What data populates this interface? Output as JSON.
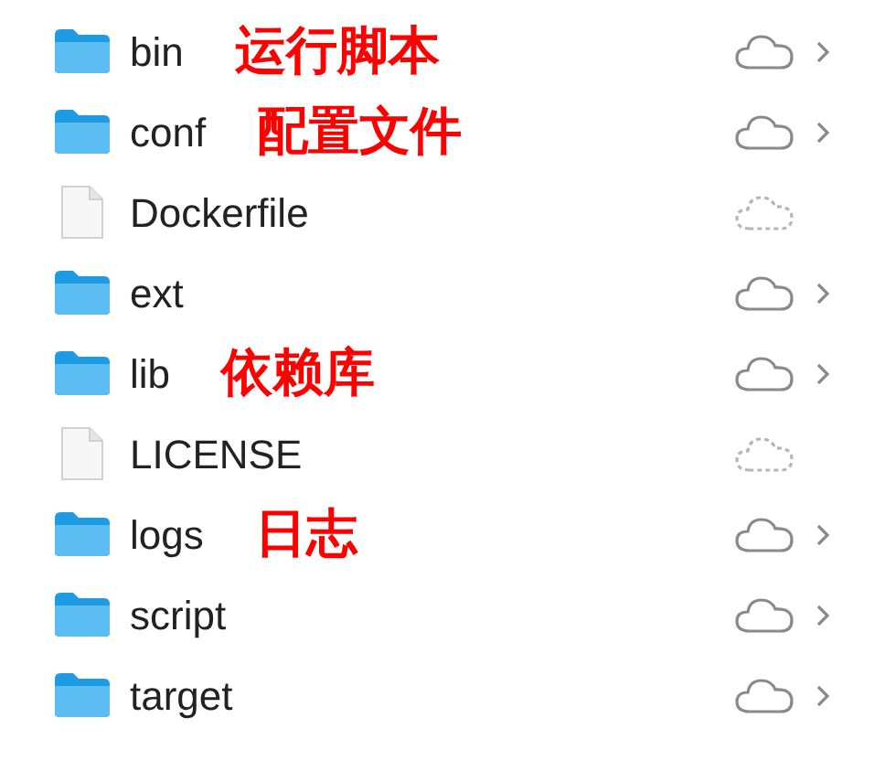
{
  "items": [
    {
      "name": "bin",
      "kind": "folder",
      "uploaded": true,
      "annotation": "运行脚本"
    },
    {
      "name": "conf",
      "kind": "folder",
      "uploaded": true,
      "annotation": "配置文件"
    },
    {
      "name": "Dockerfile",
      "kind": "file",
      "uploaded": false
    },
    {
      "name": "ext",
      "kind": "folder",
      "uploaded": true
    },
    {
      "name": "lib",
      "kind": "folder",
      "uploaded": true,
      "annotation": "依赖库"
    },
    {
      "name": "LICENSE",
      "kind": "file",
      "uploaded": false
    },
    {
      "name": "logs",
      "kind": "folder",
      "uploaded": true,
      "annotation": "日志"
    },
    {
      "name": "script",
      "kind": "folder",
      "uploaded": true
    },
    {
      "name": "target",
      "kind": "folder",
      "uploaded": true
    }
  ]
}
